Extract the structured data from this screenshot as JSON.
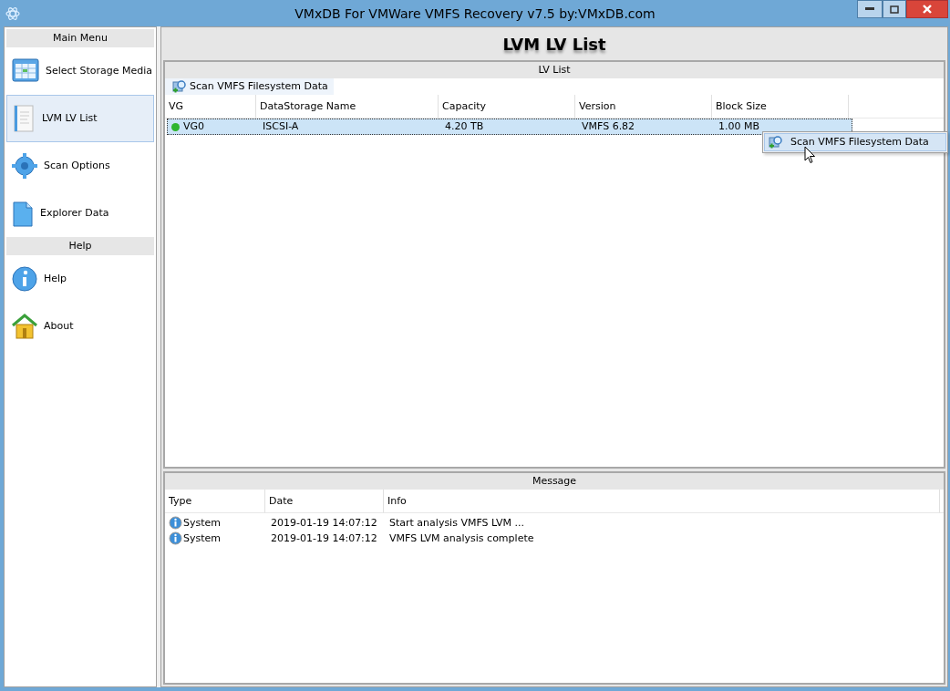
{
  "window": {
    "title": "VMxDB For VMWare VMFS Recovery v7.5 by:VMxDB.com"
  },
  "sidebar": {
    "sections": [
      {
        "title": "Main Menu",
        "items": [
          {
            "label": "Select Storage Media",
            "selected": false
          },
          {
            "label": "LVM LV List",
            "selected": true
          },
          {
            "label": "Scan Options",
            "selected": false
          },
          {
            "label": "Explorer Data",
            "selected": false
          }
        ]
      },
      {
        "title": "Help",
        "items": [
          {
            "label": "Help",
            "selected": false
          },
          {
            "label": "About",
            "selected": false
          }
        ]
      }
    ]
  },
  "page_title": "LVM LV List",
  "lv_panel": {
    "caption": "LV List",
    "toolbar_button": "Scan VMFS Filesystem Data",
    "columns": [
      "VG",
      "DataStorage Name",
      "Capacity",
      "Version",
      "Block Size"
    ],
    "rows": [
      {
        "cells": [
          "VG0",
          "ISCSI-A",
          "4.20 TB",
          "VMFS 6.82",
          "1.00 MB"
        ],
        "color": "#2fb52f",
        "selected": true
      }
    ]
  },
  "context_menu": {
    "items": [
      "Scan VMFS Filesystem Data"
    ]
  },
  "message_panel": {
    "caption": "Message",
    "columns": [
      "Type",
      "Date",
      "Info"
    ],
    "rows": [
      {
        "cells": [
          "System",
          "2019-01-19 14:07:12",
          "Start analysis VMFS LVM ..."
        ]
      },
      {
        "cells": [
          "System",
          "2019-01-19 14:07:12",
          "VMFS LVM analysis complete"
        ]
      }
    ]
  }
}
